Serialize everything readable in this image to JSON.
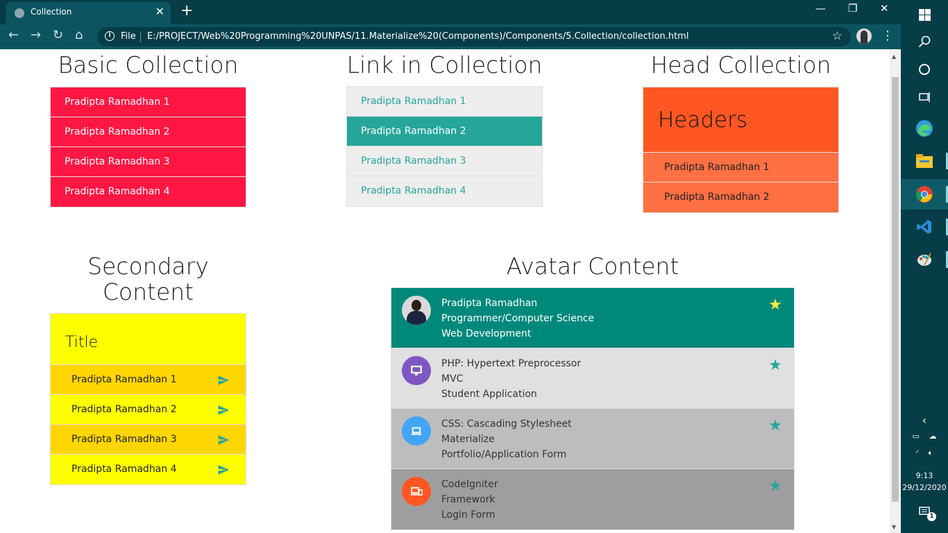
{
  "browser": {
    "tab_title": "Collection",
    "url_scheme_label": "File",
    "url": "E:/PROJECT/Web%20Programming%20UNPAS/11.Materialize%20(Components)/Components/5.Collection/collection.html"
  },
  "basic": {
    "heading": "Basic Collection",
    "items": [
      "Pradipta Ramadhan 1",
      "Pradipta Ramadhan 2",
      "Pradipta Ramadhan 3",
      "Pradipta Ramadhan 4"
    ]
  },
  "links": {
    "heading": "Link in Collection",
    "items": [
      "Pradipta Ramadhan 1",
      "Pradipta Ramadhan 2",
      "Pradipta Ramadhan 3",
      "Pradipta Ramadhan 4"
    ],
    "active_index": 1
  },
  "head": {
    "heading": "Head Collection",
    "header": "Headers",
    "items": [
      "Pradipta Ramadhan 1",
      "Pradipta Ramadhan 2"
    ]
  },
  "secondary": {
    "heading_line1": "Secondary",
    "heading_line2": "Content",
    "title": "Title",
    "items": [
      "Pradipta Ramadhan 1",
      "Pradipta Ramadhan 2",
      "Pradipta Ramadhan 3",
      "Pradipta Ramadhan 4"
    ]
  },
  "avatar": {
    "heading": "Avatar Content",
    "items": [
      {
        "title": "Pradipta Ramadhan",
        "line2": "Programmer/Computer Science",
        "line3": "Web Development",
        "icon": "profile-photo"
      },
      {
        "title": "PHP: Hypertext Preprocessor",
        "line2": "MVC",
        "line3": "Student Application",
        "icon": "desktop-icon"
      },
      {
        "title": "CSS: Cascading Stylesheet",
        "line2": "Materialize",
        "line3": "Portfolio/Application Form",
        "icon": "laptop-icon"
      },
      {
        "title": "CodeIgniter",
        "line2": "Framework",
        "line3": "Login Form",
        "icon": "devices-icon"
      }
    ]
  },
  "colors": {
    "basic_item": "#ff1744",
    "link_text": "#26a69a",
    "head_header": "#ff5722",
    "head_item": "#ff7043",
    "secondary_yellow": "#ffff00",
    "secondary_amber": "#ffd600",
    "avatar_rows": [
      "#00897b",
      "#e0e0e0",
      "#bdbdbd",
      "#9e9e9e"
    ]
  },
  "taskbar": {
    "time": "9:13",
    "date": "29/12/2020",
    "notification_count": "1"
  }
}
